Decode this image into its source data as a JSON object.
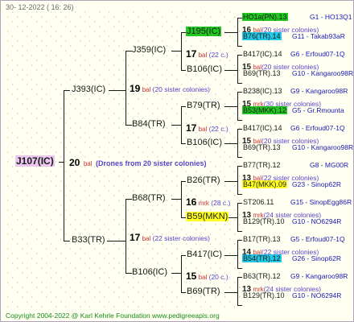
{
  "date": "30-  12-2022  ( 16:  26)",
  "footer": "Copyright 2004-2022 @ Karl Kehrle Foundation    www.pedigreeapis.org",
  "root": {
    "label": "J107(IC)",
    "num": "20",
    "bal": "bal",
    "colonies": "(Drones from 20 sister colonies)",
    "color": "#ecc8f0"
  },
  "gen1": [
    {
      "label": "J393(IC)",
      "num": "19",
      "bal": "bal",
      "colonies": "(20 sister colonies)"
    },
    {
      "label": "B33(TR)",
      "num": "17",
      "bal": "bal",
      "colonies": "(22 sister colonies)"
    }
  ],
  "gen2": [
    {
      "label": "J359(IC)",
      "num": "17",
      "bal": "bal",
      "colonies": "(22 c.)"
    },
    {
      "label": "B84(TR)",
      "num": "17",
      "bal": "bal",
      "colonies": "(22 c.)"
    },
    {
      "label": "B68(TR)",
      "num": "16",
      "bal": "mrk",
      "colonies": "(28 c.)"
    },
    {
      "label": "B106(IC)",
      "num": "15",
      "bal": "bal",
      "colonies": "(20 c.)"
    }
  ],
  "gen3": [
    {
      "label": "J195(IC)",
      "color": "#22c822"
    },
    {
      "label": "B106(IC)",
      "color": ""
    },
    {
      "label": "B79(TR)",
      "color": ""
    },
    {
      "label": "B106(IC)",
      "color": ""
    },
    {
      "label": "B26(TR)",
      "color": ""
    },
    {
      "label": "B59(MKN)",
      "color": "#ffff22"
    },
    {
      "label": "B417(IC)",
      "color": ""
    },
    {
      "label": "B69(TR)",
      "color": ""
    }
  ],
  "gen4": [
    {
      "dam": "HO1a(PN).13",
      "dam_color": "#22c822",
      "dam_info": "G1 - HO13Q1",
      "num": "16",
      "bal": "bal",
      "colonies": "(20 sister colonies)",
      "sire": "B76(TR).14",
      "sire_color": "#22c8e6",
      "sire_info": "G11 - Takab93aR"
    },
    {
      "dam": "B417(IC).14",
      "dam_color": "",
      "dam_info": "G6 - Erfoud07-1Q",
      "num": "15",
      "bal": "bal",
      "colonies": "(20 sister colonies)",
      "sire": "B69(TR).13",
      "sire_color": "",
      "sire_info": "G10 - Kangaroo98R"
    },
    {
      "dam": "B238(IC).13",
      "dam_color": "",
      "dam_info": "G9 - Kangaroo98R",
      "num": "15",
      "bal": "mrk",
      "colonies": "(30 sister colonies)",
      "sire": "B53(MKK).12",
      "sire_color": "#22c822",
      "sire_info": "G5 - Gr.Rmounta"
    },
    {
      "dam": "B417(IC).14",
      "dam_color": "",
      "dam_info": "G6 - Erfoud07-1Q",
      "num": "15",
      "bal": "bal",
      "colonies": "(20 sister colonies)",
      "sire": "B69(TR).13",
      "sire_color": "",
      "sire_info": "G10 - Kangaroo98R"
    },
    {
      "dam": "B77(TR).12",
      "dam_color": "",
      "dam_info": "G8 - MG00R",
      "num": "13",
      "bal": "bal",
      "colonies": "(22 sister colonies)",
      "sire": "B47(MKK).09",
      "sire_color": "#ffff22",
      "sire_info": "G23 - Sinop62R"
    },
    {
      "dam": "ST206.11",
      "dam_color": "",
      "dam_info": "G15 - SinopEgg86R",
      "num": "13",
      "bal": "mrk",
      "colonies": "(24 sister colonies)",
      "sire": "B129(TR).10",
      "sire_color": "",
      "sire_info": "G10 - NO6294R"
    },
    {
      "dam": "B17(TR).13",
      "dam_color": "",
      "dam_info": "G5 - Erfoud07-1Q",
      "num": "14",
      "bal": "bal",
      "colonies": "(22 sister colonies)",
      "sire": "B54(TR).12",
      "sire_color": "#22c8e6",
      "sire_info": "G26 - Sinop62R"
    },
    {
      "dam": "B63(TR).12",
      "dam_color": "",
      "dam_info": "G9 - Kangaroo98R",
      "num": "13",
      "bal": "mrk",
      "colonies": "(24 sister colonies)",
      "sire": "B129(TR).10",
      "sire_color": "",
      "sire_info": "G10 - NO6294R"
    }
  ]
}
